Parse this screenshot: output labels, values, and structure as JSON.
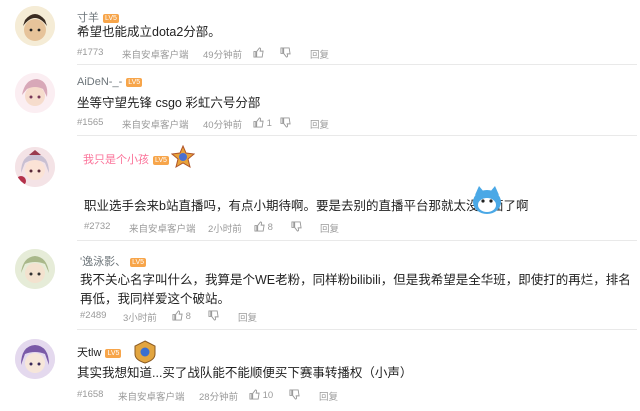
{
  "comments": [
    {
      "user": "寸羊",
      "level": "LV5",
      "text": "希望也能成立dota2分部。",
      "floor": "#1773",
      "device": "来自安卓客户端",
      "time": "49分钟前",
      "likes": "",
      "reply": "回复"
    },
    {
      "user": "AiDeN-_-",
      "level": "LV5",
      "text": "坐等守望先锋 csgo 彩虹六号分部",
      "floor": "#1565",
      "device": "来自安卓客户端",
      "time": "40分钟前",
      "likes": "1",
      "reply": "回复"
    },
    {
      "user": "我只是个小孩",
      "level": "LV5",
      "text": "职业选手会来b站直播吗，有点小期待啊。要是去别的直播平台那就太没台面了啊",
      "floor": "#2732",
      "device": "来自安卓客户端",
      "time": "2小时前",
      "likes": "8",
      "reply": "回复"
    },
    {
      "user": "'逸泳影、",
      "level": "LV5",
      "text": "我不关心名字叫什么，我算是个WE老粉，同样粉bilibili，但是我希望是全华班，即使打的再烂，排名再低，我同样爱这个破站。",
      "floor": "#2489",
      "device": "",
      "time": "3小时前",
      "likes": "8",
      "reply": "回复"
    },
    {
      "user": "天tlw",
      "level": "LV5",
      "text": "其实我想知道...买了战队能不能顺便买下赛事转播权（小声）",
      "floor": "#1658",
      "device": "来自安卓客户端",
      "time": "28分钟前",
      "likes": "10",
      "reply": "回复"
    }
  ],
  "colors": {
    "vip_name": "#fb7299",
    "name": "#6d757a",
    "meta": "#9a9a9a",
    "text": "#222222"
  }
}
